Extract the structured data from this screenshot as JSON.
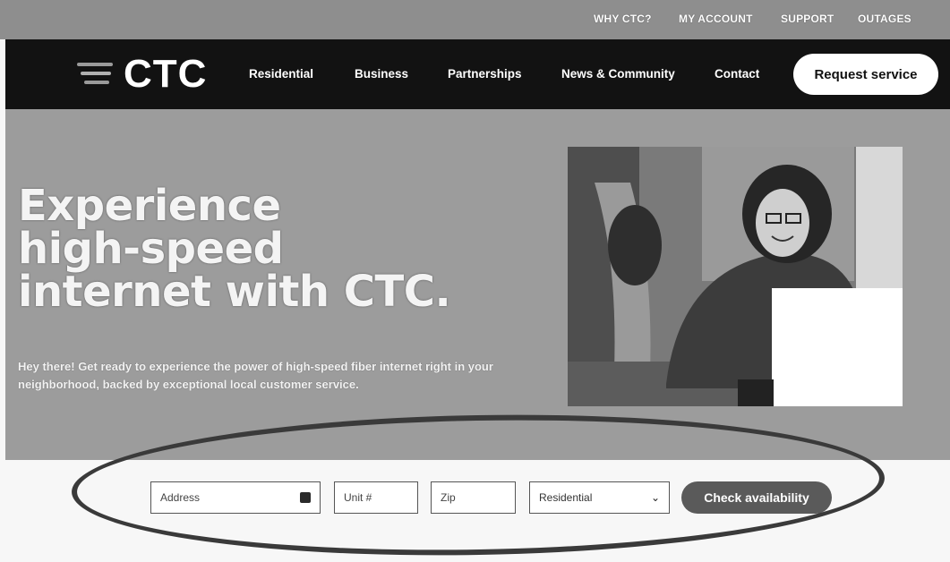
{
  "utility_nav": {
    "items": [
      {
        "label": "WHY CTC?"
      },
      {
        "label": "MY ACCOUNT"
      },
      {
        "label": "SUPPORT"
      },
      {
        "label": "OUTAGES"
      }
    ]
  },
  "header": {
    "logo_text": "CTC",
    "nav": [
      {
        "label": "Residential"
      },
      {
        "label": "Business"
      },
      {
        "label": "Partnerships"
      },
      {
        "label": "News & Community"
      },
      {
        "label": "Contact"
      }
    ],
    "cta_label": "Request service"
  },
  "hero": {
    "headline_lines": [
      "Experience",
      "high-speed",
      "internet with CTC."
    ],
    "subtext": "Hey there! Get ready to experience the power of high-speed fiber internet right in your neighborhood, backed by exceptional local customer service."
  },
  "availability_form": {
    "address_placeholder": "Address",
    "unit_placeholder": "Unit #",
    "zip_placeholder": "Zip",
    "service_type_selected": "Residential",
    "submit_label": "Check availability"
  }
}
